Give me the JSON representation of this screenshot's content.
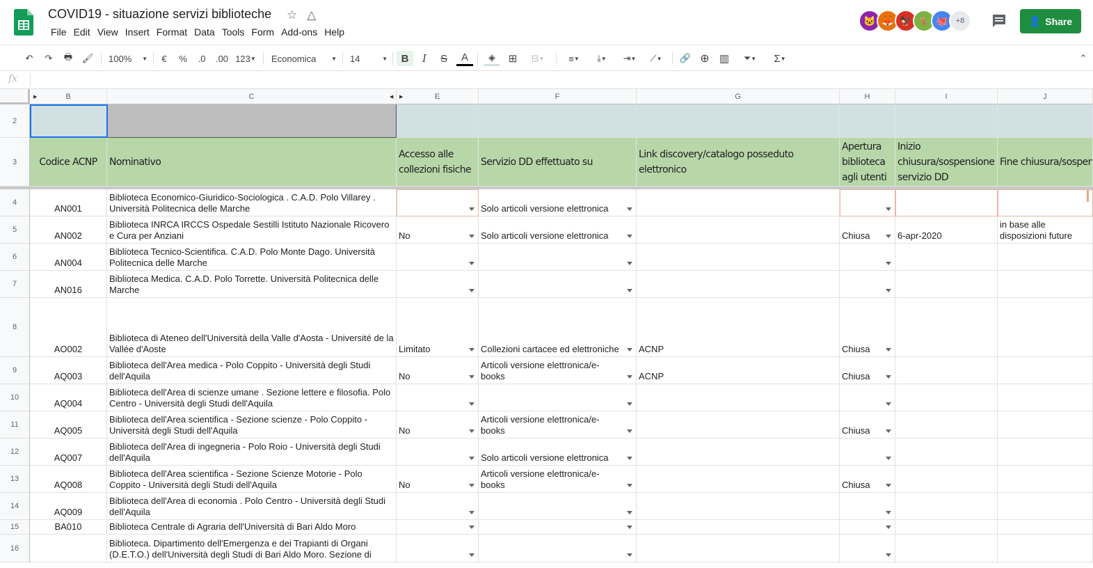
{
  "app": {
    "title": "COVID19 - situazione servizi biblioteche",
    "menus": [
      "File",
      "Edit",
      "View",
      "Insert",
      "Format",
      "Data",
      "Tools",
      "Form",
      "Add-ons",
      "Help"
    ],
    "share_label": "Share",
    "collaborators_more": "+8",
    "collaborator_colors": [
      "#8e24aa",
      "#e8710a",
      "#d93025",
      "#7cb342",
      "#4285f4"
    ]
  },
  "toolbar": {
    "zoom": "100%",
    "currency": "€",
    "percent": "%",
    "dec_less": ".0",
    "dec_more": ".00",
    "format_more": "123",
    "font": "Economica",
    "font_size": "14",
    "bold": "B",
    "italic": "I",
    "strike": "S",
    "text_color": "A"
  },
  "formula_bar": {
    "fx": "fx",
    "value": ""
  },
  "columns": [
    {
      "id": "B",
      "label": "B"
    },
    {
      "id": "C",
      "label": "C"
    },
    {
      "id": "E",
      "label": "E"
    },
    {
      "id": "F",
      "label": "F"
    },
    {
      "id": "G",
      "label": "G"
    },
    {
      "id": "H",
      "label": "H"
    },
    {
      "id": "I",
      "label": "I"
    },
    {
      "id": "J",
      "label": "J"
    }
  ],
  "header_row": {
    "number": "3",
    "cells": [
      "Codice ACNP",
      "Nominativo",
      "Accesso alle collezioni fisiche",
      "Servizio DD effettuato su",
      "Link discovery/catalogo posseduto elettronico",
      "Apertura biblioteca agli utenti",
      "Inizio chiusura/sospensione servizio DD",
      "Fine chiusura/sospensione servizio DD"
    ]
  },
  "row2": {
    "number": "2"
  },
  "rows": [
    {
      "n": "4",
      "code": "AN001",
      "name": "Biblioteca Economico-Giuridico-Sociologica . C.A.D. Polo Villarey . Università Politecnica delle Marche",
      "access": "",
      "dd": "Solo articoli versione elettronica",
      "link": "",
      "open": "",
      "start": "",
      "end": ""
    },
    {
      "n": "5",
      "code": "AN002",
      "name": "Biblioteca INRCA IRCCS Ospedale Sestilli Istituto Nazionale Ricovero e Cura per Anziani",
      "access": "No",
      "dd": "Solo articoli versione elettronica",
      "link": "",
      "open": "Chiusa",
      "start": "6-apr-2020",
      "end": "in base alle disposizioni future"
    },
    {
      "n": "6",
      "code": "AN004",
      "name": "Biblioteca Tecnico-Scientifica. C.A.D. Polo Monte Dago. Università Politecnica delle Marche",
      "access": "",
      "dd": "",
      "link": "",
      "open": "",
      "start": "",
      "end": ""
    },
    {
      "n": "7",
      "code": "AN016",
      "name": "Biblioteca Medica. C.A.D. Polo Torrette. Università Politecnica delle Marche",
      "access": "",
      "dd": "",
      "link": "",
      "open": "",
      "start": "",
      "end": ""
    },
    {
      "n": "8",
      "code": "AO002",
      "name": "Biblioteca di Ateneo dell'Università della Valle d'Aosta - Université de la Vallée d'Aoste",
      "access": "Limitato",
      "dd": "Collezioni cartacee ed elettroniche",
      "link": "ACNP",
      "open": "Chiusa",
      "start": "",
      "end": ""
    },
    {
      "n": "9",
      "code": "AQ003",
      "name": "Biblioteca dell'Area medica - Polo Coppito - Università degli Studi dell'Aquila",
      "access": "No",
      "dd": "Articoli versione elettronica/e-books",
      "link": "ACNP",
      "open": "Chiusa",
      "start": "",
      "end": ""
    },
    {
      "n": "10",
      "code": "AQ004",
      "name": "Biblioteca dell'Area di scienze umane . Sezione lettere e filosofia. Polo Centro - Università degli Studi dell'Aquila",
      "access": "",
      "dd": "",
      "link": "",
      "open": "",
      "start": "",
      "end": ""
    },
    {
      "n": "11",
      "code": "AQ005",
      "name": "Biblioteca dell'Area scientifica - Sezione scienze - Polo Coppito - Università degli Studi dell'Aquila",
      "access": "No",
      "dd": "Articoli versione elettronica/e-books",
      "link": "",
      "open": "Chiusa",
      "start": "",
      "end": ""
    },
    {
      "n": "12",
      "code": "AQ007",
      "name": "Biblioteca dell'Area di ingegneria - Polo Roio - Università degli Studi dell'Aquila",
      "access": "",
      "dd": "Solo articoli versione elettronica",
      "link": "",
      "open": "",
      "start": "",
      "end": ""
    },
    {
      "n": "13",
      "code": "AQ008",
      "name": "Biblioteca dell'Area scientifica - Sezione Scienze Motorie - Polo Coppito - Università degli Studi dell'Aquila",
      "access": "No",
      "dd": "Articoli versione elettronica/e-books",
      "link": "",
      "open": "Chiusa",
      "start": "",
      "end": ""
    },
    {
      "n": "14",
      "code": "AQ009",
      "name": "Biblioteca dell'Area di economia . Polo Centro - Università degli Studi dell'Aquila",
      "access": "",
      "dd": "",
      "link": "",
      "open": "",
      "start": "",
      "end": ""
    },
    {
      "n": "15",
      "code": "BA010",
      "name": "Biblioteca Centrale di Agraria dell'Università di Bari Aldo Moro",
      "access": "",
      "dd": "",
      "link": "",
      "open": "",
      "start": "",
      "end": ""
    },
    {
      "n": "16",
      "code": "",
      "name": "Biblioteca. Dipartimento dell'Emergenza e dei Trapianti di Organi (D.E.T.O.) dell'Università degli Studi di Bari Aldo Moro. Sezione di",
      "access": "",
      "dd": "",
      "link": "",
      "open": "",
      "start": "",
      "end": ""
    }
  ]
}
